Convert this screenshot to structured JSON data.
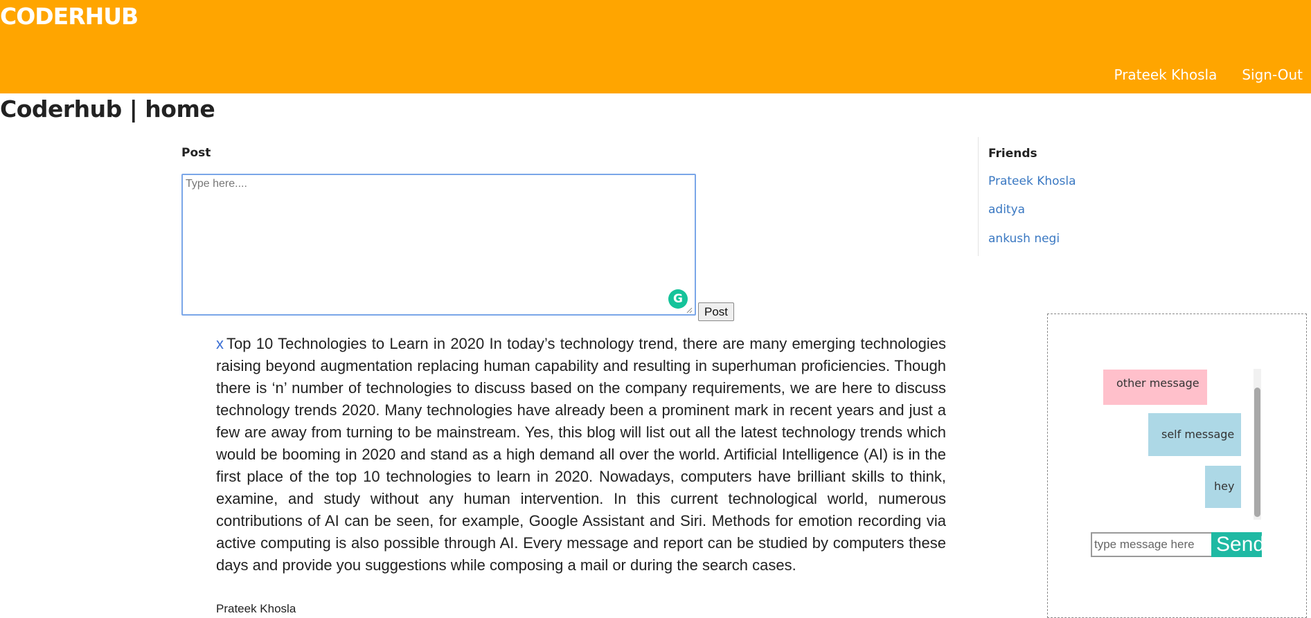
{
  "header": {
    "brand": "CODERHUB",
    "nav": {
      "user": "Prateek Khosla",
      "signout": "Sign-Out"
    }
  },
  "page": {
    "title": "Coderhub | home"
  },
  "post_form": {
    "label": "Post",
    "placeholder": "Type here....",
    "submit_label": "Post"
  },
  "posts": [
    {
      "delete_label": "x",
      "content": "Top 10 Technologies to Learn in 2020 In today’s technology trend, there are many emerging technologies raising beyond augmentation replacing human capability and resulting in superhuman proficiencies. Though there is ‘n’ number of technologies to discuss based on the company requirements, we are here to discuss technology trends 2020. Many technologies have already been a prominent mark in recent years and just a few are away from turning to be mainstream. Yes, this blog will list out all the latest technology trends which would be booming in 2020 and stand as a high demand all over the world. Artificial Intelligence (AI) is in the first place of the top 10 technologies to learn in 2020. Nowadays, computers have brilliant skills to think, examine, and study without any human intervention. In this current technological world, numerous contributions of AI can be seen, for example, Google Assistant and Siri. Methods for emotion recording via active computing is also possible through AI. Every message and report can be studied by computers these days and provide you suggestions while composing a mail or during the search cases.",
      "author": "Prateek Khosla"
    }
  ],
  "friends": {
    "title": "Friends",
    "items": [
      "Prateek Khosla",
      "aditya",
      "ankush negi"
    ]
  },
  "chat": {
    "messages": [
      {
        "type": "other",
        "text": "other message"
      },
      {
        "type": "self",
        "text": "self message"
      },
      {
        "type": "self",
        "text": "hey"
      }
    ],
    "input_placeholder": "type message here",
    "send_label": "Send"
  },
  "icons": {
    "grammarly": "grammarly-icon",
    "resize": "resize-grip-icon"
  },
  "colors": {
    "header_bg": "#ffa500",
    "link": "#3a78c2",
    "other_message_bg": "#ffc0cb",
    "self_message_bg": "#add8e6",
    "send_button_bg": "#1fb9a3",
    "grammarly": "#15c39a"
  }
}
